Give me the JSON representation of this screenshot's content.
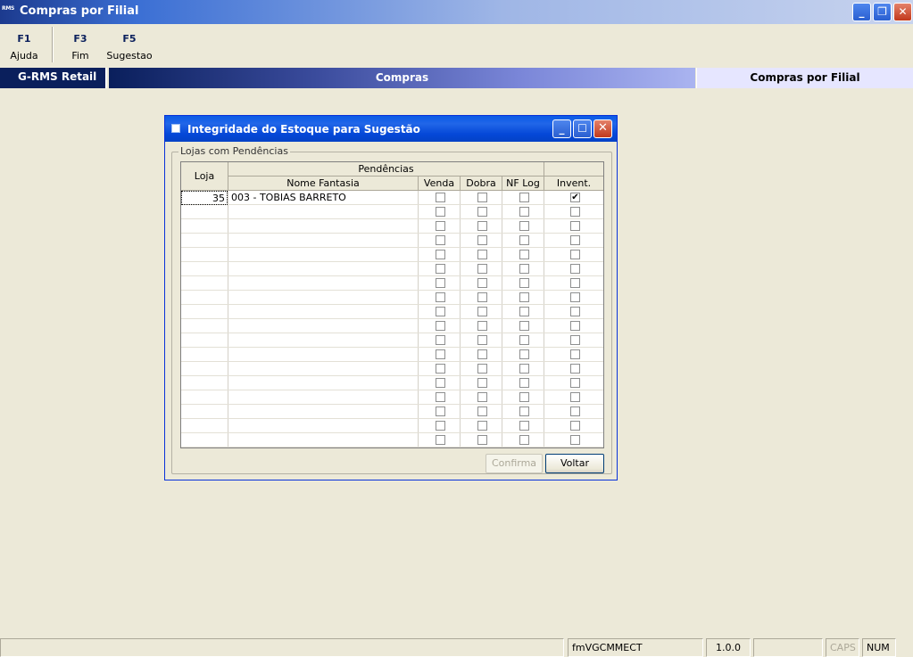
{
  "window": {
    "app_icon": "RMS",
    "title": "Compras por Filial",
    "buttons": [
      "minimize",
      "restore",
      "close"
    ]
  },
  "toolbar": [
    {
      "key": "F1",
      "label": "Ajuda"
    },
    {
      "key": "F3",
      "label": "Fim"
    },
    {
      "key": "F5",
      "label": "Sugestao"
    }
  ],
  "band": {
    "left": "G-RMS Retail",
    "center": "Compras",
    "right": "Compras por Filial"
  },
  "dialog": {
    "title": "Integridade do Estoque para Sugestão",
    "group_label": "Lojas com Pendências",
    "headers": {
      "loja": "Loja",
      "pendencias": "Pendências",
      "nome": "Nome Fantasia",
      "venda": "Venda",
      "dobra": "Dobra",
      "nflog": "NF Log",
      "invent": "Invent."
    },
    "rows": [
      {
        "loja": "35",
        "nome": "003 - TOBIAS BARRETO",
        "venda": false,
        "dobra": false,
        "nflog": false,
        "invent": true
      }
    ],
    "empty_rows": 17,
    "confirm_label": "Confirma",
    "back_label": "Voltar"
  },
  "status": {
    "panel1": "",
    "form": "fmVGCMMECT",
    "version": "1.0.0",
    "panel4": "",
    "caps": "CAPS",
    "num": "NUM"
  },
  "colors": {
    "accent": "#0a1f5c",
    "dialog_title": "#0548d8",
    "background": "#ece9d8"
  }
}
